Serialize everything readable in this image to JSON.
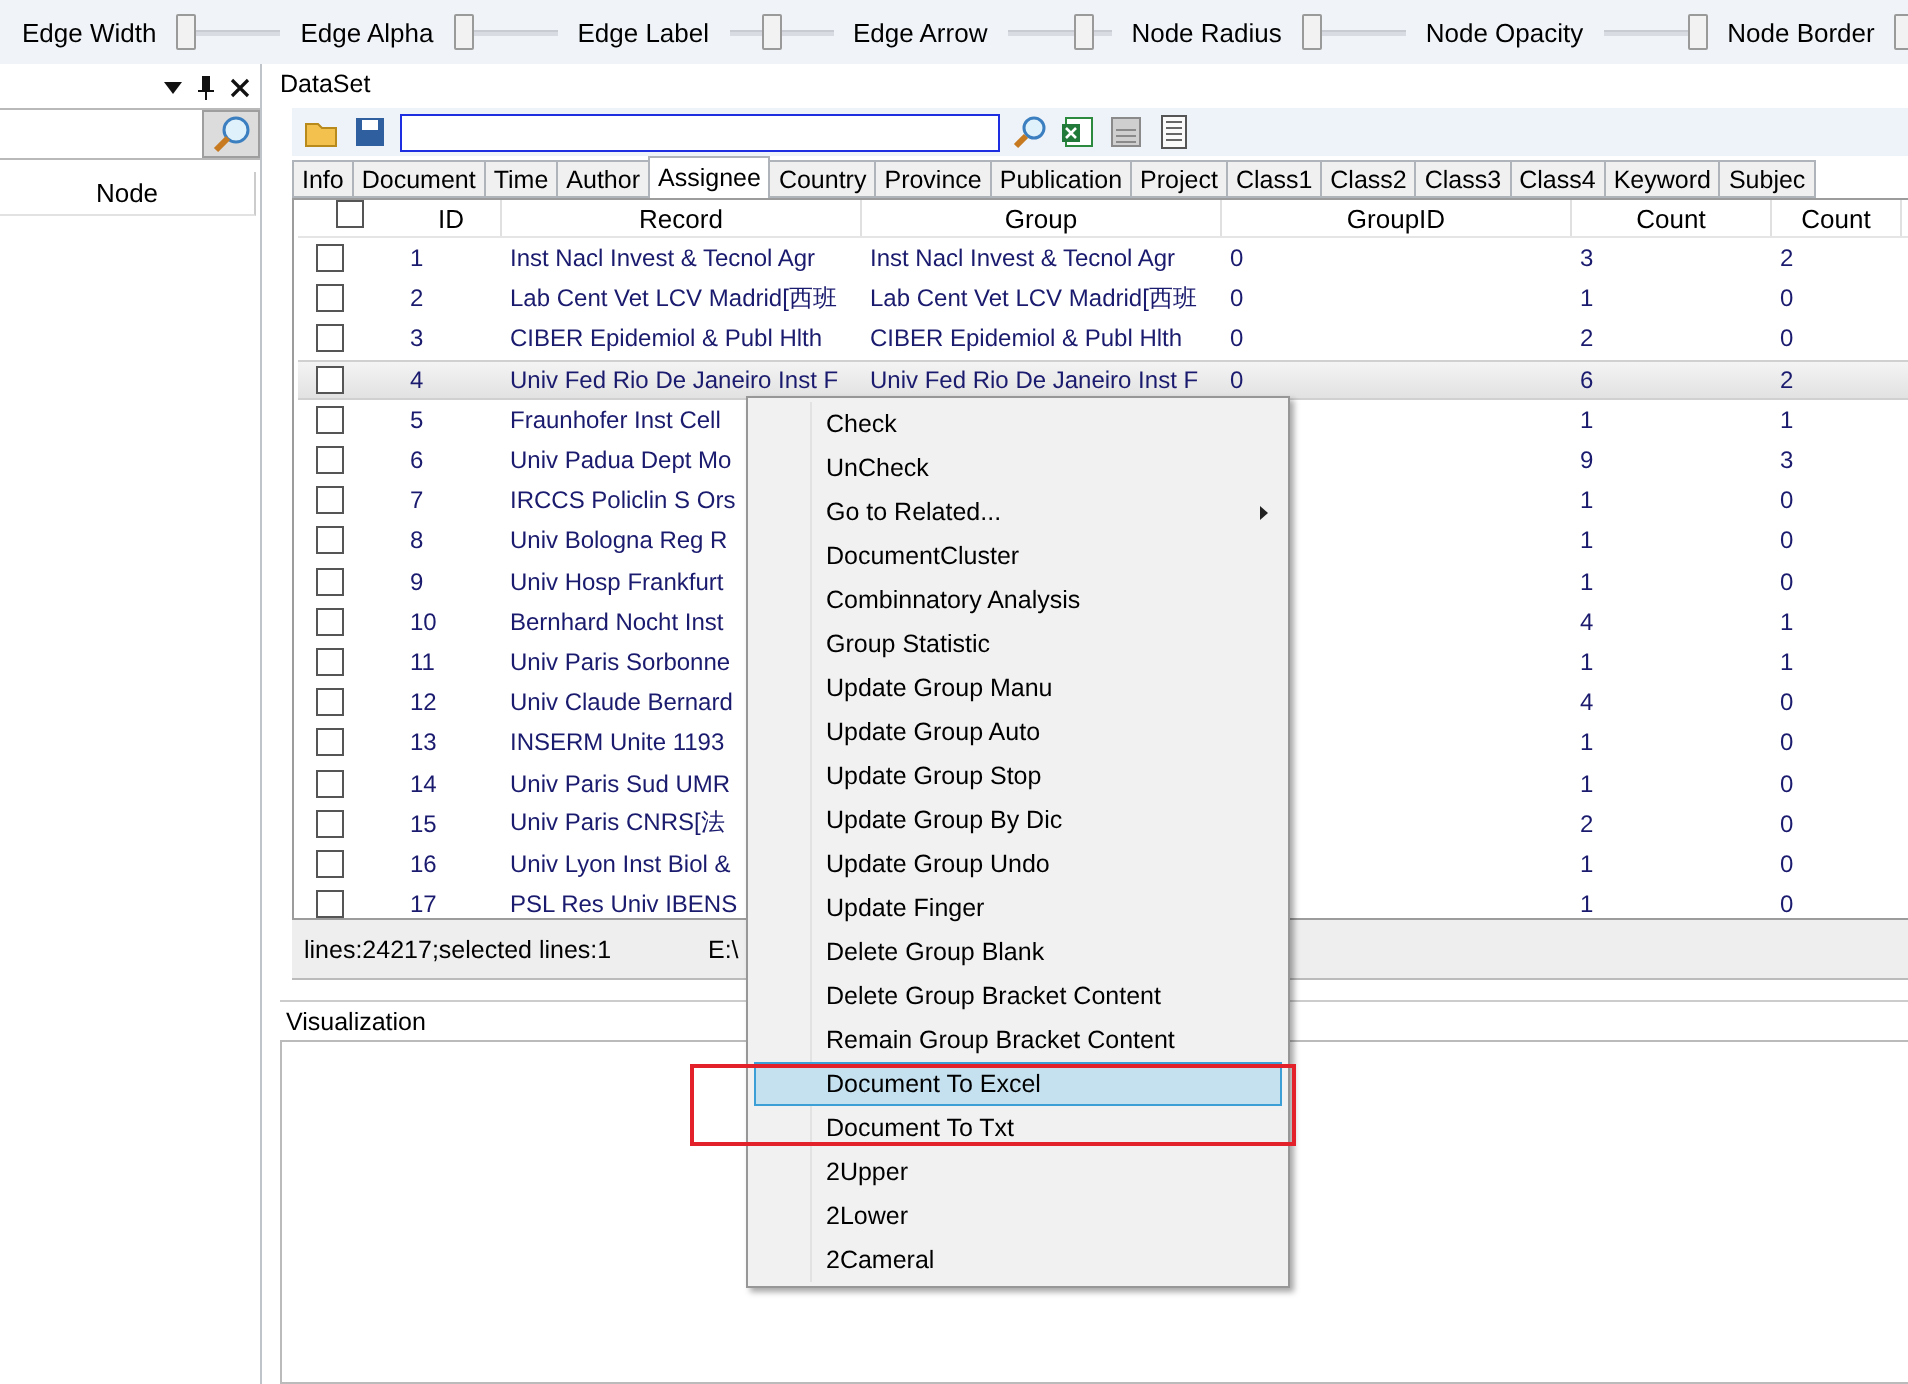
{
  "graph_toolbar": [
    {
      "label": "Edge Width",
      "level": 0
    },
    {
      "label": "Edge Alpha",
      "level": 0
    },
    {
      "label": "Edge Label",
      "level": 0.4
    },
    {
      "label": "Edge Arrow",
      "level": 0.8
    },
    {
      "label": "Node Radius",
      "level": 0
    },
    {
      "label": "Node Opacity",
      "level": 1
    },
    {
      "label": "Node Border",
      "level": 0
    }
  ],
  "left_panel": {
    "column": "Node"
  },
  "dataset": {
    "title": "DataSet",
    "tabs": [
      {
        "label": "Info",
        "selected": false
      },
      {
        "label": "Document",
        "selected": false
      },
      {
        "label": "Time",
        "selected": false
      },
      {
        "label": "Author",
        "selected": false
      },
      {
        "label": "Assignee",
        "selected": true
      },
      {
        "label": "Country",
        "selected": false
      },
      {
        "label": "Province",
        "selected": false
      },
      {
        "label": "Publication",
        "selected": false
      },
      {
        "label": "Project",
        "selected": false
      },
      {
        "label": "Class1",
        "selected": false
      },
      {
        "label": "Class2",
        "selected": false
      },
      {
        "label": "Class3",
        "selected": false
      },
      {
        "label": "Class4",
        "selected": false
      },
      {
        "label": "Keyword",
        "selected": false
      },
      {
        "label": "Subjec",
        "selected": false
      }
    ],
    "table": {
      "header_checked": false,
      "columns": [
        "ID",
        "Record",
        "Group",
        "GroupID",
        "Count",
        "Count"
      ],
      "rows": [
        {
          "checked": false,
          "selected": false,
          "id": "1",
          "record": "Inst Nacl Invest & Tecnol Agr",
          "group": "Inst Nacl Invest & Tecnol Agr",
          "group_id": "0",
          "count": "3",
          "count_2": "2"
        },
        {
          "checked": false,
          "selected": false,
          "id": "2",
          "record": "Lab Cent Vet LCV Madrid[西班",
          "group": "Lab Cent Vet LCV Madrid[西班",
          "group_id": "0",
          "count": "1",
          "count_2": "0"
        },
        {
          "checked": false,
          "selected": false,
          "id": "3",
          "record": "CIBER Epidemiol & Publ Hlth",
          "group": "CIBER Epidemiol & Publ Hlth",
          "group_id": "0",
          "count": "2",
          "count_2": "0"
        },
        {
          "checked": false,
          "selected": true,
          "id": "4",
          "record": "Univ Fed Rio De Janeiro Inst F",
          "group": "Univ Fed Rio De Janeiro Inst F",
          "group_id": "0",
          "count": "6",
          "count_2": "2"
        },
        {
          "checked": false,
          "selected": false,
          "id": "5",
          "record": "Fraunhofer Inst Cell",
          "count": "1",
          "count_2": "1"
        },
        {
          "checked": false,
          "selected": false,
          "id": "6",
          "record": "Univ Padua Dept Mo",
          "count": "9",
          "count_2": "3"
        },
        {
          "checked": false,
          "selected": false,
          "id": "7",
          "record": "IRCCS Policlin S Ors",
          "count": "1",
          "count_2": "0"
        },
        {
          "checked": false,
          "selected": false,
          "id": "8",
          "record": "Univ Bologna Reg R",
          "count": "1",
          "count_2": "0"
        },
        {
          "checked": false,
          "selected": false,
          "id": "9",
          "record": "Univ Hosp Frankfurt",
          "count": "1",
          "count_2": "0"
        },
        {
          "checked": false,
          "selected": false,
          "id": "10",
          "record": "Bernhard Nocht Inst",
          "count": "4",
          "count_2": "1"
        },
        {
          "checked": false,
          "selected": false,
          "id": "11",
          "record": "Univ Paris Sorbonne",
          "count": "1",
          "count_2": "1"
        },
        {
          "checked": false,
          "selected": false,
          "id": "12",
          "record": "Univ Claude Bernard",
          "count": "4",
          "count_2": "0"
        },
        {
          "checked": false,
          "selected": false,
          "id": "13",
          "record": "INSERM Unite 1193",
          "count": "1",
          "count_2": "0"
        },
        {
          "checked": false,
          "selected": false,
          "id": "14",
          "record": "Univ Paris Sud UMR",
          "count": "1",
          "count_2": "0"
        },
        {
          "checked": false,
          "selected": false,
          "id": "15",
          "record": "Univ Paris CNRS[法",
          "count": "2",
          "count_2": "0"
        },
        {
          "checked": false,
          "selected": false,
          "id": "16",
          "record": "Univ Lyon Inst Biol &",
          "count": "1",
          "count_2": "0"
        },
        {
          "checked": false,
          "selected": false,
          "id": "17",
          "record": "PSL Res Univ IBENS",
          "count": "1",
          "count_2": "0"
        }
      ]
    },
    "status_bar": [
      "lines:24217;selected lines:1",
      "E:\\"
    ]
  },
  "visualization": {
    "title": "Visualization"
  },
  "context_menu": [
    {
      "label": "Check",
      "selected": false
    },
    {
      "label": "UnCheck",
      "selected": false
    },
    {
      "label": "Go to Related...",
      "selected": false,
      "submenu": true
    },
    {
      "label": "DocumentCluster",
      "selected": false
    },
    {
      "label": "Combinnatory Analysis",
      "selected": false
    },
    {
      "label": "Group Statistic",
      "selected": false
    },
    {
      "label": "Update Group Manu",
      "selected": false
    },
    {
      "label": "Update Group Auto",
      "selected": false
    },
    {
      "label": "Update Group Stop",
      "selected": false
    },
    {
      "label": "Update Group By Dic",
      "selected": false
    },
    {
      "label": "Update Group Undo",
      "selected": false
    },
    {
      "label": "Update Finger",
      "selected": false
    },
    {
      "label": "Delete Group Blank",
      "selected": false
    },
    {
      "label": "Delete Group Bracket Content",
      "selected": false
    },
    {
      "label": "Remain Group Bracket Content",
      "selected": false
    },
    {
      "label": "Document To Excel",
      "selected": true
    },
    {
      "label": "Document To Txt",
      "selected": false
    },
    {
      "label": "2Upper",
      "selected": false
    },
    {
      "label": "2Lower",
      "selected": false
    },
    {
      "label": "2Cameral",
      "selected": false
    }
  ]
}
